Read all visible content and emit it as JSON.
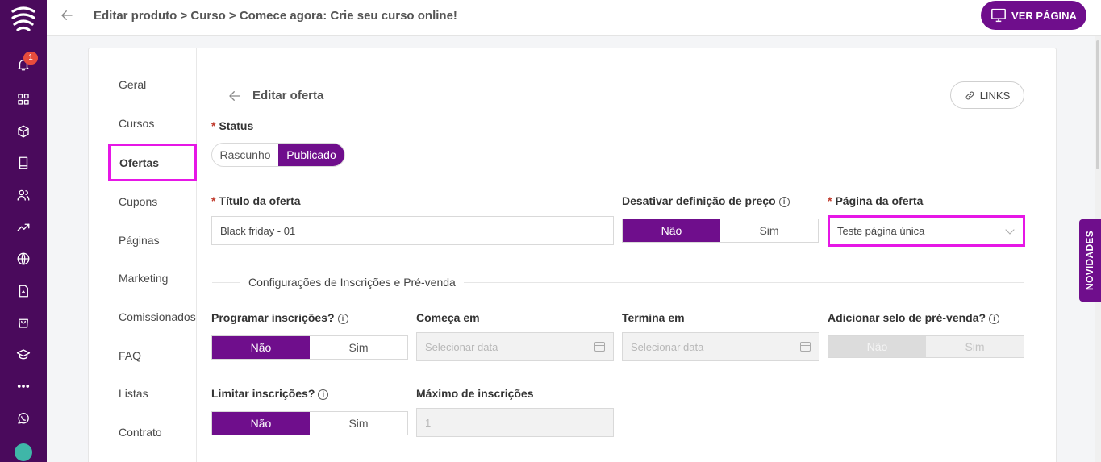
{
  "header": {
    "breadcrumb": "Editar produto > Curso > Comece agora: Crie seu curso online!",
    "view_page_label": "VER PÁGINA"
  },
  "rail": {
    "notification_count": "1"
  },
  "subnav": {
    "items": [
      "Geral",
      "Cursos",
      "Ofertas",
      "Cupons",
      "Páginas",
      "Marketing",
      "Comissionados",
      "FAQ",
      "Listas",
      "Contrato"
    ],
    "active": "Ofertas"
  },
  "section": {
    "title": "Editar oferta",
    "links_label": "LINKS"
  },
  "status": {
    "label": "Status",
    "options": [
      "Rascunho",
      "Publicado"
    ],
    "selected": "Publicado"
  },
  "offer_title": {
    "label": "Título da oferta",
    "value": "Black friday - 01"
  },
  "disable_price": {
    "label": "Desativar definição de preço",
    "options": [
      "Não",
      "Sim"
    ],
    "selected": "Não"
  },
  "offer_page": {
    "label": "Página da oferta",
    "value": "Teste página única"
  },
  "divider_label": "Configurações de Inscrições e Pré-venda",
  "schedule": {
    "label": "Programar inscrições?",
    "options": [
      "Não",
      "Sim"
    ],
    "selected": "Não"
  },
  "starts": {
    "label": "Começa em",
    "placeholder": "Selecionar data"
  },
  "ends": {
    "label": "Termina em",
    "placeholder": "Selecionar data"
  },
  "presale": {
    "label": "Adicionar selo de pré-venda?",
    "options": [
      "Não",
      "Sim"
    ],
    "selected": "Não"
  },
  "limit": {
    "label": "Limitar inscrições?",
    "options": [
      "Não",
      "Sim"
    ],
    "selected": "Não"
  },
  "max": {
    "label": "Máximo de inscrições",
    "value": "1"
  },
  "side_tab": "NOVIDADES",
  "colors": {
    "primary": "#6f0e8c",
    "rail": "#4a0a5c",
    "highlight": "#e617e6"
  }
}
